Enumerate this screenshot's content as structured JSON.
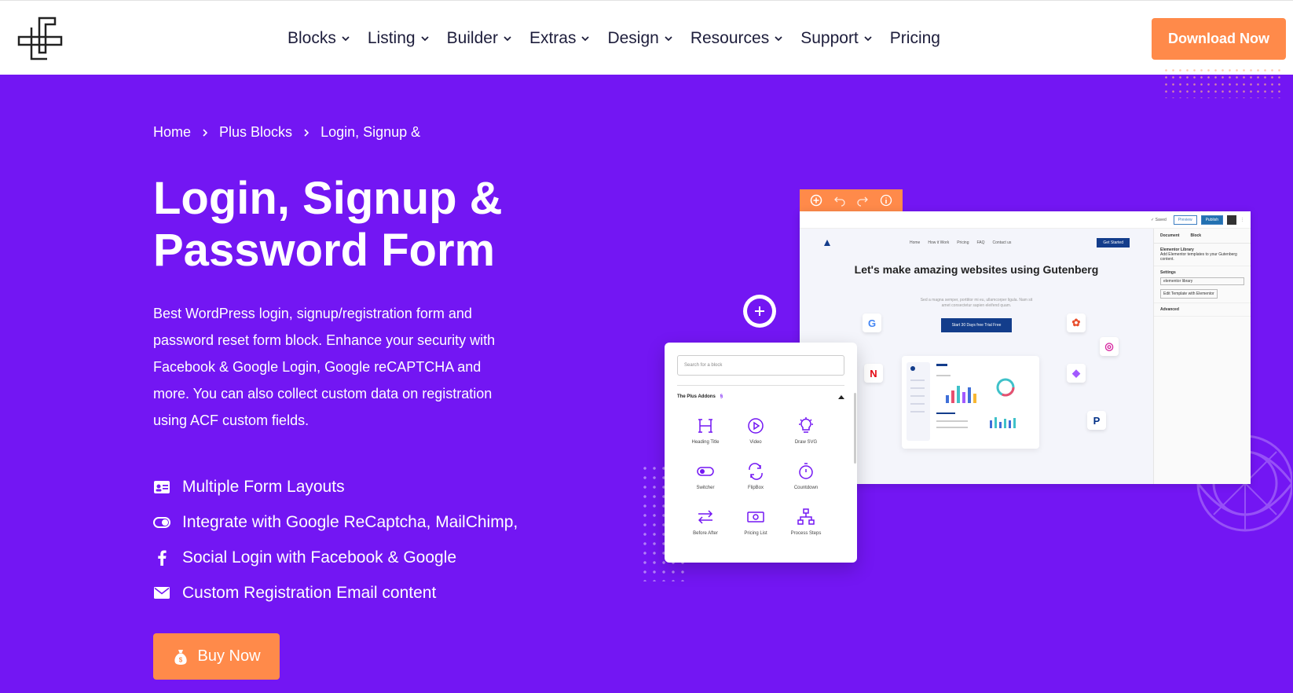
{
  "header": {
    "nav": [
      {
        "label": "Blocks",
        "has_dropdown": true
      },
      {
        "label": "Listing",
        "has_dropdown": true
      },
      {
        "label": "Builder",
        "has_dropdown": true
      },
      {
        "label": "Extras",
        "has_dropdown": true
      },
      {
        "label": "Design",
        "has_dropdown": true
      },
      {
        "label": "Resources",
        "has_dropdown": true
      },
      {
        "label": "Support",
        "has_dropdown": true
      },
      {
        "label": "Pricing",
        "has_dropdown": false
      }
    ],
    "download_label": "Download Now"
  },
  "breadcrumb": [
    "Home",
    "Plus Blocks",
    "Login, Signup &"
  ],
  "hero": {
    "title": "Login, Signup & Password Form",
    "description": "Best WordPress login, signup/registration form and password reset form block. Enhance your security with Facebook & Google Login, Google reCAPTCHA and more. You can also collect custom data on registration using ACF custom fields.",
    "features": [
      {
        "icon": "id-card-icon",
        "label": "Multiple Form Layouts"
      },
      {
        "icon": "toggle-icon",
        "label": "Integrate with Google ReCaptcha, MailChimp,"
      },
      {
        "icon": "facebook-icon",
        "label": "Social Login with Facebook & Google"
      },
      {
        "icon": "envelope-icon",
        "label": "Custom Registration Email content"
      }
    ],
    "buy_label": "Buy Now"
  },
  "mockup": {
    "topbar": {
      "saved": "✓ Saved",
      "preview": "Preview",
      "publish": "Publish"
    },
    "side": {
      "tab_document": "Document",
      "tab_block": "Block",
      "library_title": "Elementor Library",
      "library_desc": "Add Elementor templates to your Gutenberg content.",
      "settings_label": "Settings",
      "select_value": "elementor library",
      "edit_button": "Edit Template with Elementor",
      "advanced_label": "Advanced"
    },
    "mini_nav": {
      "links": [
        "Home",
        "How it Work",
        "Pricing",
        "FAQ",
        "Contact us"
      ],
      "cta": "Get Started"
    },
    "headline": "Let's make amazing websites using Gutenberg",
    "sub": "Sed a magna semper, porttitor mi eu, ullamcorper ligula. Nam sit amet consectetur sapien eleifend quam.",
    "cta": "Start 30 Days free Trial Free",
    "inserter": {
      "search_placeholder": "Search for a block",
      "group_label": "The Plus Addons",
      "blocks": [
        {
          "icon": "heading-icon",
          "label": "Heading Title"
        },
        {
          "icon": "video-icon",
          "label": "Video"
        },
        {
          "icon": "bulb-icon",
          "label": "Draw SVG"
        },
        {
          "icon": "switcher-icon",
          "label": "Switcher"
        },
        {
          "icon": "flipbox-icon",
          "label": "FlipBox"
        },
        {
          "icon": "countdown-icon",
          "label": "Countdown"
        },
        {
          "icon": "before-after-icon",
          "label": "Before After"
        },
        {
          "icon": "pricing-list-icon",
          "label": "Pricing List"
        },
        {
          "icon": "process-steps-icon",
          "label": "Process Steps"
        }
      ]
    }
  },
  "colors": {
    "background": "#7316f3",
    "accent": "#ff8a4a",
    "nav_text": "#1d1d3b"
  }
}
